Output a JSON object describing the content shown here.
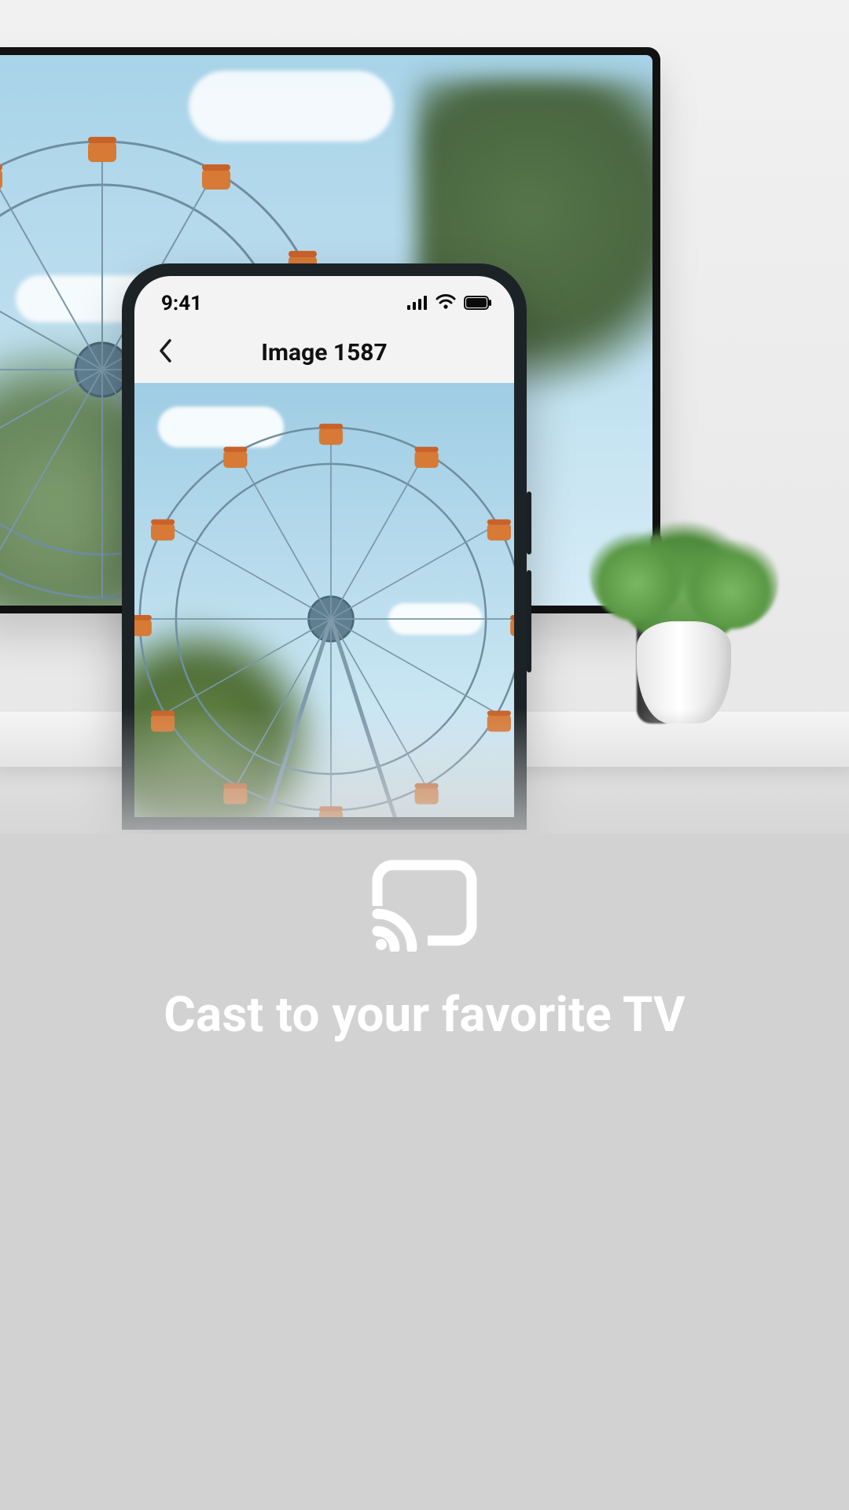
{
  "statusbar": {
    "time": "9:41"
  },
  "appbar": {
    "title": "Image 1587"
  },
  "promo": {
    "headline": "Cast to your favorite TV"
  },
  "icons": {
    "cast": "cast-icon",
    "back": "chevron-left-icon",
    "cellular": "cellular-icon",
    "wifi": "wifi-icon",
    "battery": "battery-icon"
  }
}
